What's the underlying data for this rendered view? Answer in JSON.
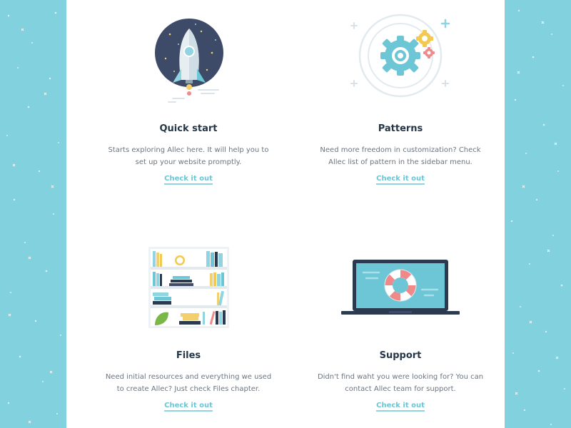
{
  "cards": [
    {
      "title": "Quick start",
      "description": "Starts exploring Allec here. It will help you to set up your website promptly.",
      "link": "Check it out",
      "icon": "rocket-icon"
    },
    {
      "title": "Patterns",
      "description": "Need more freedom in customization? Check Allec list of pattern in the sidebar menu.",
      "link": "Check it out",
      "icon": "gears-icon"
    },
    {
      "title": "Files",
      "description": "Need initial resources and everything we used to create Allec? Just check Files chapter.",
      "link": "Check it out",
      "icon": "bookshelf-icon"
    },
    {
      "title": "Support",
      "description": "Didn't find waht you were looking for? You can contact Allec team for support.",
      "link": "Check it out",
      "icon": "laptop-lifebuoy-icon"
    }
  ],
  "colors": {
    "background": "#81d2de",
    "panel": "#ffffff",
    "title": "#253648",
    "text": "#6b7580",
    "link": "#6cc6d6"
  }
}
